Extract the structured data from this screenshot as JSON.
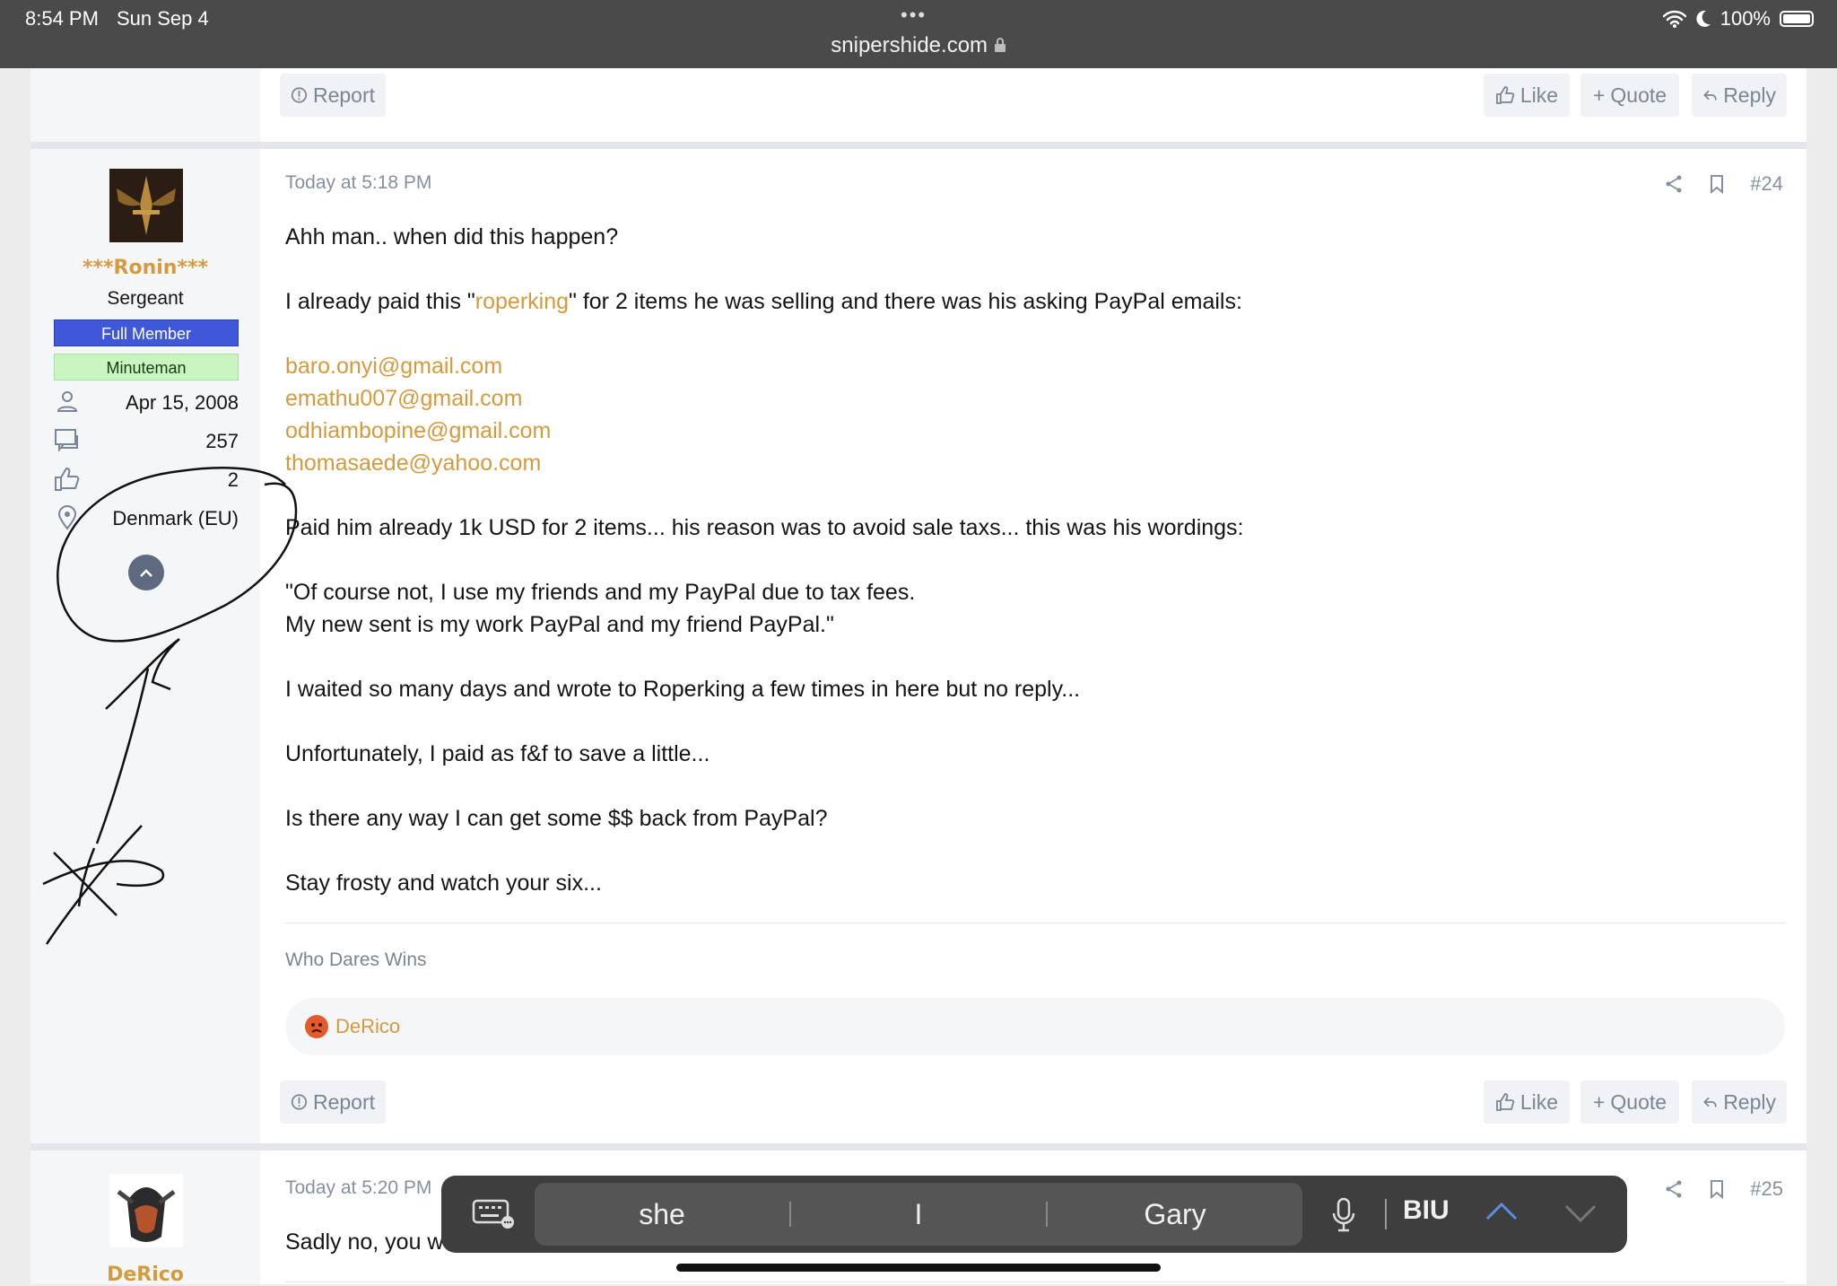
{
  "status": {
    "time": "8:54 PM",
    "date": "Sun Sep 4",
    "url": "snipershide.com",
    "battery": "100%"
  },
  "actions": {
    "report": "Report",
    "like": "Like",
    "quote": "Quote",
    "reply": "Reply"
  },
  "post24": {
    "date": "Today at 5:18 PM",
    "number": "#24",
    "user": {
      "name": "***Ronin***",
      "title": "Sergeant",
      "banner1": "Full Member",
      "banner2": "Minuteman",
      "joined": "Apr 15, 2008",
      "messages": "257",
      "reactions": "2",
      "location": "Denmark (EU)"
    },
    "body": {
      "p1": "Ahh man.. when did this happen?",
      "p2_pre": "I already paid this \"",
      "p2_link": "roperking",
      "p2_post": "\" for 2 items he was selling and there was his asking PayPal emails:",
      "emails": [
        "baro.onyi@gmail.com",
        "emathu007@gmail.com",
        "odhiambopine@gmail.com",
        "thomasaede@yahoo.com"
      ],
      "p3": "Paid him already 1k USD for 2 items... his reason was to avoid sale taxs... this was his wordings:",
      "p4a": "\"Of course not, I use my friends and my PayPal due to tax fees.",
      "p4b": "My new sent is my work PayPal and my friend PayPal.\"",
      "p5": "I waited so many days and wrote to Roperking a few times in here but no reply...",
      "p6": "Unfortunately, I paid as f&f to save a little...",
      "p7": "Is there any way I can get some $$ back from PayPal?",
      "p8": "Stay frosty and watch your six..."
    },
    "signature": "Who Dares Wins",
    "reaction_user": "DeRico"
  },
  "post25": {
    "date": "Today at 5:20 PM",
    "number": "#25",
    "username": "DeRico",
    "body_start": "Sadly no, you w"
  },
  "predictive": {
    "words": [
      "she",
      "I",
      "Gary"
    ],
    "format": "BIU"
  },
  "colors": {
    "link": "#d49a3e",
    "full_member": "#3f57d9",
    "minuteman": "#c9f5c0",
    "status_bar": "#4a4a4a"
  }
}
